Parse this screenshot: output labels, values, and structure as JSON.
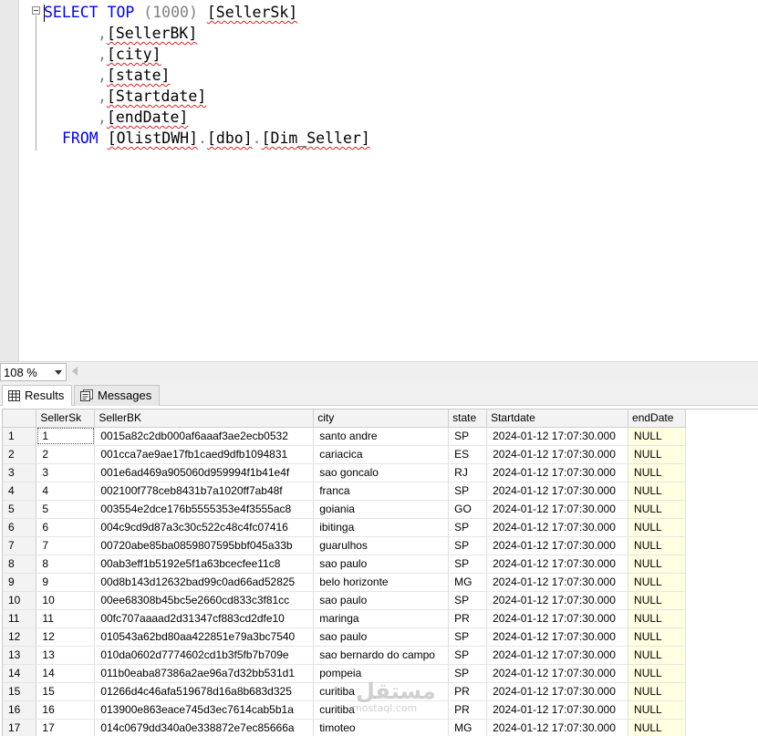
{
  "editor": {
    "lines": [
      {
        "parts": [
          [
            "kw",
            "SELECT"
          ],
          [
            "sp",
            " "
          ],
          [
            "kw",
            "TOP"
          ],
          [
            "sp",
            " "
          ],
          [
            "op",
            "(1000)"
          ],
          [
            "sp",
            " "
          ],
          [
            "idf",
            "[SellerSk]"
          ]
        ]
      },
      {
        "parts": [
          [
            "op",
            ","
          ],
          [
            "idf",
            "[SellerBK]"
          ]
        ]
      },
      {
        "parts": [
          [
            "op",
            ","
          ],
          [
            "idf",
            "[city]"
          ]
        ]
      },
      {
        "parts": [
          [
            "op",
            ","
          ],
          [
            "idf",
            "[state]"
          ]
        ]
      },
      {
        "parts": [
          [
            "op",
            ","
          ],
          [
            "idf",
            "[Startdate]"
          ]
        ]
      },
      {
        "parts": [
          [
            "op",
            ","
          ],
          [
            "idf",
            "[endDate]"
          ]
        ]
      },
      {
        "parts": [
          [
            "kw",
            "FROM"
          ],
          [
            "sp",
            " "
          ],
          [
            "idf",
            "[OlistDWH]"
          ],
          [
            "op",
            "."
          ],
          [
            "idf",
            "[dbo]"
          ],
          [
            "op",
            "."
          ],
          [
            "idf",
            "[Dim_Seller]"
          ]
        ]
      }
    ]
  },
  "status": {
    "zoom": "108 %"
  },
  "tabs": {
    "results": "Results",
    "messages": "Messages"
  },
  "grid": {
    "columns": [
      "SellerSk",
      "SellerBK",
      "city",
      "state",
      "Startdate",
      "endDate"
    ],
    "rows": [
      [
        "1",
        "0015a82c2db000af6aaaf3ae2ecb0532",
        "santo andre",
        "SP",
        "2024-01-12 17:07:30.000",
        "NULL"
      ],
      [
        "2",
        "001cca7ae9ae17fb1caed9dfb1094831",
        "cariacica",
        "ES",
        "2024-01-12 17:07:30.000",
        "NULL"
      ],
      [
        "3",
        "001e6ad469a905060d959994f1b41e4f",
        "sao goncalo",
        "RJ",
        "2024-01-12 17:07:30.000",
        "NULL"
      ],
      [
        "4",
        "002100f778ceb8431b7a1020ff7ab48f",
        "franca",
        "SP",
        "2024-01-12 17:07:30.000",
        "NULL"
      ],
      [
        "5",
        "003554e2dce176b5555353e4f3555ac8",
        "goiania",
        "GO",
        "2024-01-12 17:07:30.000",
        "NULL"
      ],
      [
        "6",
        "004c9cd9d87a3c30c522c48c4fc07416",
        "ibitinga",
        "SP",
        "2024-01-12 17:07:30.000",
        "NULL"
      ],
      [
        "7",
        "00720abe85ba0859807595bbf045a33b",
        "guarulhos",
        "SP",
        "2024-01-12 17:07:30.000",
        "NULL"
      ],
      [
        "8",
        "00ab3eff1b5192e5f1a63bcecfee11c8",
        "sao paulo",
        "SP",
        "2024-01-12 17:07:30.000",
        "NULL"
      ],
      [
        "9",
        "00d8b143d12632bad99c0ad66ad52825",
        "belo horizonte",
        "MG",
        "2024-01-12 17:07:30.000",
        "NULL"
      ],
      [
        "10",
        "00ee68308b45bc5e2660cd833c3f81cc",
        "sao paulo",
        "SP",
        "2024-01-12 17:07:30.000",
        "NULL"
      ],
      [
        "11",
        "00fc707aaaad2d31347cf883cd2dfe10",
        "maringa",
        "PR",
        "2024-01-12 17:07:30.000",
        "NULL"
      ],
      [
        "12",
        "010543a62bd80aa422851e79a3bc7540",
        "sao paulo",
        "SP",
        "2024-01-12 17:07:30.000",
        "NULL"
      ],
      [
        "13",
        "010da0602d7774602cd1b3f5fb7b709e",
        "sao bernardo do campo",
        "SP",
        "2024-01-12 17:07:30.000",
        "NULL"
      ],
      [
        "14",
        "011b0eaba87386a2ae96a7d32bb531d1",
        "pompeia",
        "SP",
        "2024-01-12 17:07:30.000",
        "NULL"
      ],
      [
        "15",
        "01266d4c46afa519678d16a8b683d325",
        "curitiba",
        "PR",
        "2024-01-12 17:07:30.000",
        "NULL"
      ],
      [
        "16",
        "013900e863eace745d3ec7614cab5b1a",
        "curitiba",
        "PR",
        "2024-01-12 17:07:30.000",
        "NULL"
      ],
      [
        "17",
        "014c0679dd340a0e338872e7ec85666a",
        "timoteo",
        "MG",
        "2024-01-12 17:07:30.000",
        "NULL"
      ]
    ]
  },
  "watermark": {
    "arabic": "مستقل",
    "latin": "mostaql.com"
  }
}
